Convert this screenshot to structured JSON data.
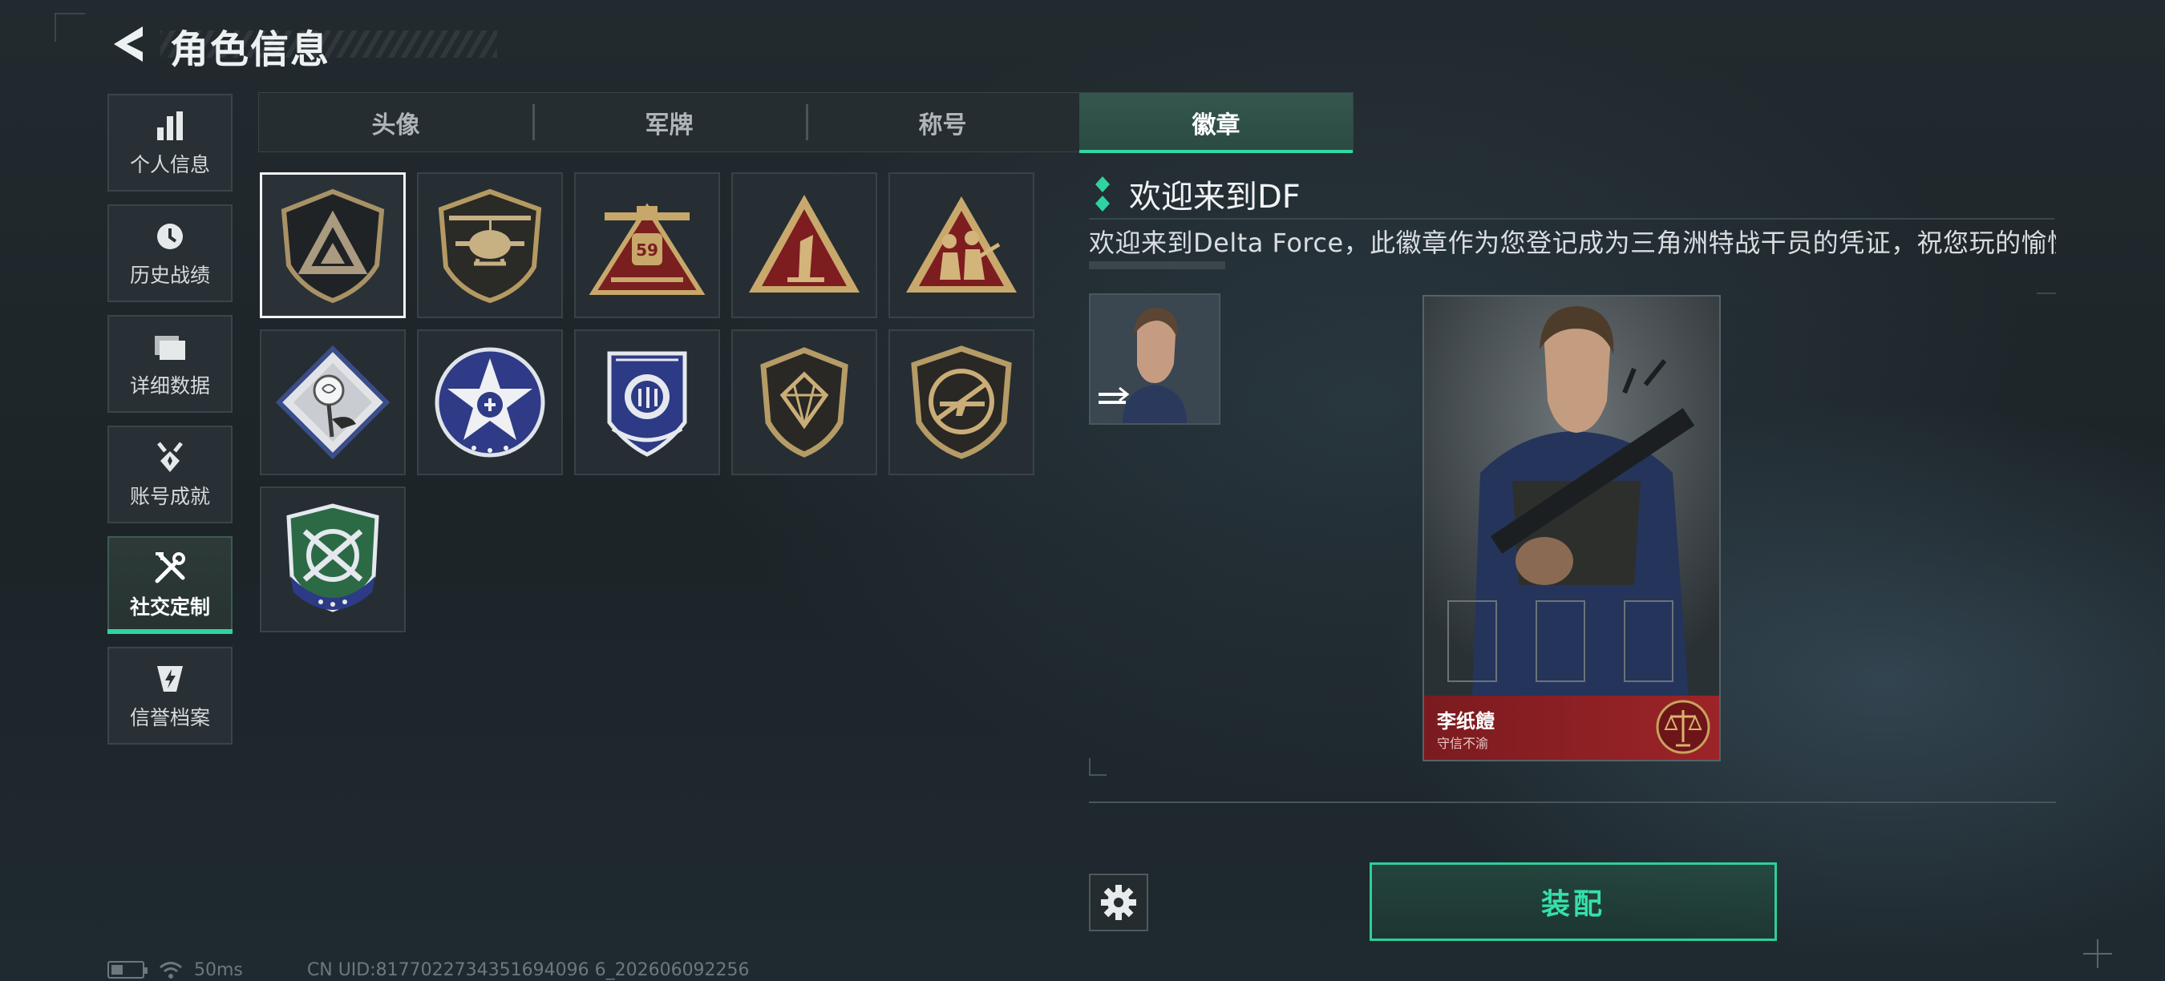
{
  "header": {
    "title": "角色信息"
  },
  "sidebar": {
    "items": [
      {
        "label": "个人信息",
        "icon": "bar-chart-icon",
        "active": false
      },
      {
        "label": "历史战绩",
        "icon": "clock-icon",
        "active": false
      },
      {
        "label": "详细数据",
        "icon": "folder-icon",
        "active": false
      },
      {
        "label": "账号成就",
        "icon": "medal-icon",
        "active": false
      },
      {
        "label": "社交定制",
        "icon": "tools-icon",
        "active": true
      },
      {
        "label": "信誉档案",
        "icon": "lightning-shield-icon",
        "active": false
      }
    ]
  },
  "tabs": [
    {
      "label": "头像",
      "active": false
    },
    {
      "label": "军牌",
      "active": false
    },
    {
      "label": "称号",
      "active": false
    },
    {
      "label": "徽章",
      "active": true
    }
  ],
  "badges": [
    {
      "icon": "delta-shield-badge-icon",
      "selected": true
    },
    {
      "icon": "helicopter-badge-icon"
    },
    {
      "icon": "plane-59-badge-icon"
    },
    {
      "icon": "number-one-triangle-badge-icon"
    },
    {
      "icon": "soldiers-triangle-badge-icon"
    },
    {
      "icon": "rose-diamond-badge-icon"
    },
    {
      "icon": "blue-star-round-badge-icon"
    },
    {
      "icon": "blue-wreath-badge-icon"
    },
    {
      "icon": "gem-shield-badge-icon"
    },
    {
      "icon": "rifle-shield-badge-icon"
    },
    {
      "icon": "green-crossed-shield-badge-icon"
    }
  ],
  "detail": {
    "badge_title": "欢迎来到DF",
    "badge_description": "欢迎来到Delta Force，此徽章作为您登记成为三角洲特战干员的凭证，祝您玩的愉快",
    "card": {
      "player_name": "李纸饐",
      "player_subtitle": "守信不渝"
    },
    "equip_label": "装配"
  },
  "status_bar": {
    "ping": "50ms",
    "uid": "CN UID:8177022734351694096 6_202606092256"
  },
  "colors": {
    "accent": "#2fd3a0",
    "card_red": "#9c2428",
    "gold": "#b89a62"
  }
}
